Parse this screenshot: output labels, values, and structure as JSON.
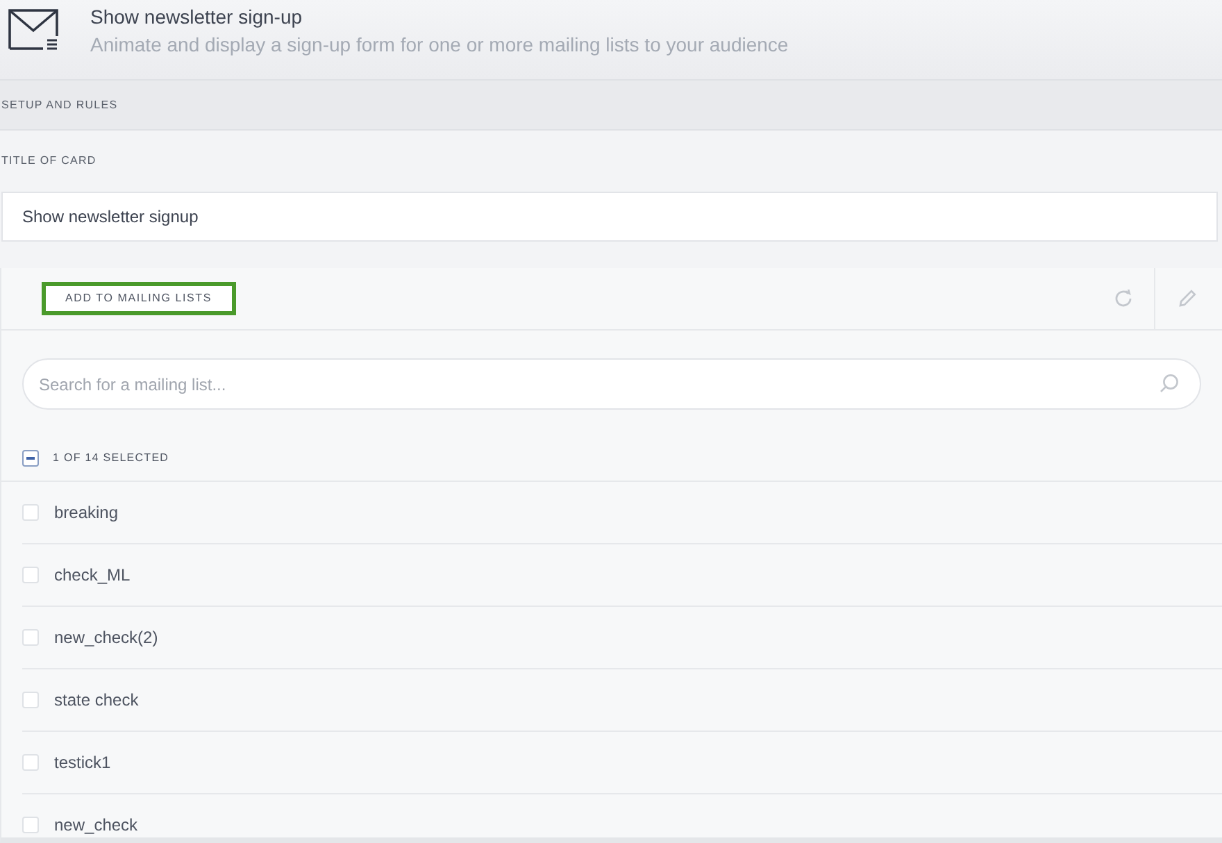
{
  "header": {
    "title": "Show newsletter sign-up",
    "subtitle": "Animate and display a sign-up form for one or more mailing lists to your audience"
  },
  "section": {
    "label": "SETUP AND RULES"
  },
  "title_field": {
    "label": "TITLE OF CARD",
    "value": "Show newsletter signup"
  },
  "mailing_panel": {
    "button": {
      "label": "ADD TO MAILING LISTS",
      "focused": true
    },
    "search": {
      "placeholder": "Search for a mailing list..."
    },
    "selection": {
      "label": "1 OF 14 SELECTED",
      "partial": true
    },
    "lists": [
      {
        "name": "breaking",
        "checked": false
      },
      {
        "name": "check_ML",
        "checked": false
      },
      {
        "name": "new_check(2)",
        "checked": false
      },
      {
        "name": "state check",
        "checked": false
      },
      {
        "name": "testick1",
        "checked": false
      },
      {
        "name": "new_check",
        "checked": false
      }
    ]
  }
}
